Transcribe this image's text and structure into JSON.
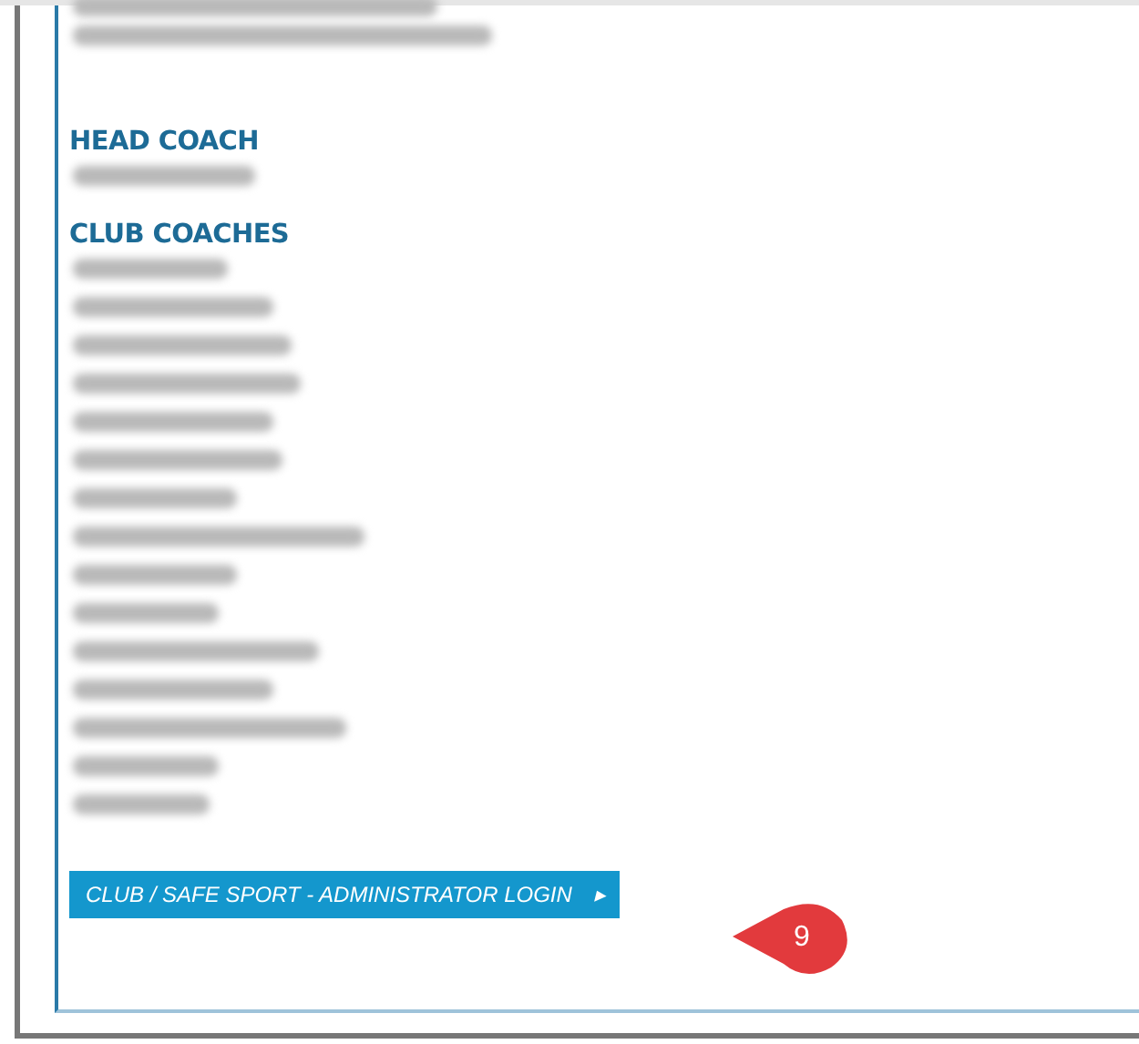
{
  "contact": {
    "lines": [
      {
        "kind": "blurred"
      },
      {
        "kind": "blurred"
      }
    ]
  },
  "sections": [
    {
      "heading": "HEAD COACH",
      "names": [
        {
          "kind": "blurred"
        }
      ]
    },
    {
      "heading": "CLUB COACHES",
      "names": [
        {
          "kind": "blurred"
        },
        {
          "kind": "blurred"
        },
        {
          "kind": "blurred"
        },
        {
          "kind": "blurred"
        },
        {
          "kind": "blurred"
        },
        {
          "kind": "blurred"
        },
        {
          "kind": "blurred"
        },
        {
          "kind": "blurred"
        },
        {
          "kind": "blurred"
        },
        {
          "kind": "blurred"
        },
        {
          "kind": "blurred"
        },
        {
          "kind": "blurred"
        },
        {
          "kind": "blurred"
        },
        {
          "kind": "blurred"
        },
        {
          "kind": "blurred"
        }
      ]
    }
  ],
  "login_button": {
    "label": "CLUB / SAFE SPORT - ADMINISTRATOR LOGIN",
    "arrow": "▸"
  },
  "callout": {
    "number": "9"
  }
}
